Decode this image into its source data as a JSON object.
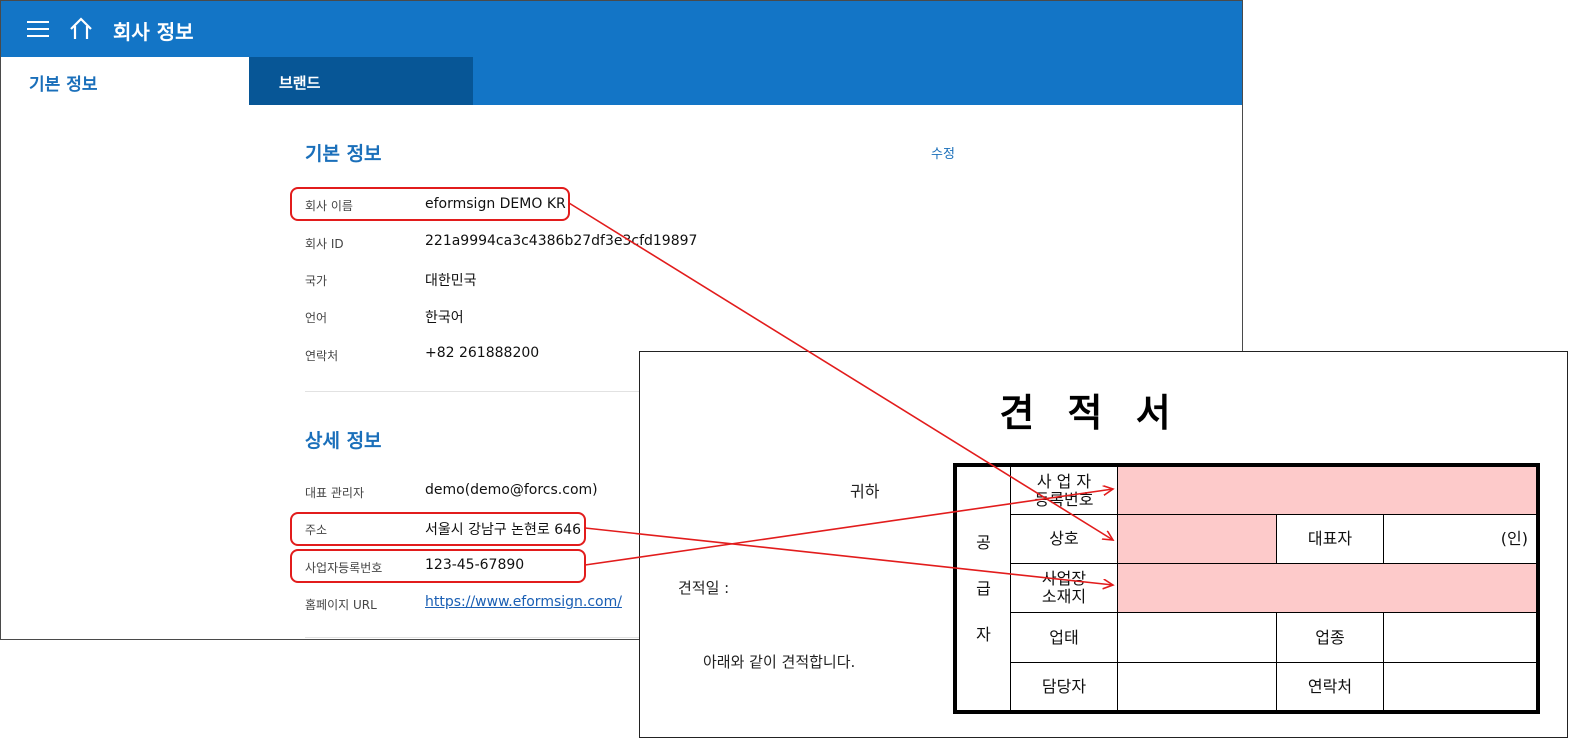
{
  "app": {
    "title": "회사 정보",
    "tabs": {
      "basic": "기본 정보",
      "brand": "브랜드"
    }
  },
  "basic_info": {
    "title": "기본 정보",
    "edit": "수정",
    "fields": [
      {
        "label": "회사 이름",
        "value": "eformsign DEMO KR"
      },
      {
        "label": "회사 ID",
        "value": "221a9994ca3c4386b27df3e3cfd19897"
      },
      {
        "label": "국가",
        "value": "대한민국"
      },
      {
        "label": "언어",
        "value": "한국어"
      },
      {
        "label": "연락처",
        "value": "+82 261888200"
      }
    ]
  },
  "detail_info": {
    "title": "상세 정보",
    "fields": [
      {
        "label": "대표 관리자",
        "value": "demo(demo@forcs.com)"
      },
      {
        "label": "주소",
        "value": "서울시 강남구 논현로 646"
      },
      {
        "label": "사업자등록번호",
        "value": "123-45-67890"
      },
      {
        "label": "홈페이지 URL",
        "value": "https://www.eformsign.com/"
      }
    ]
  },
  "quote": {
    "title": "견 적 서",
    "recipient": "귀하",
    "date_label": "견적일 :",
    "statement": "아래와 같이 견적합니다.",
    "supplier": {
      "side_label": [
        "공",
        "급",
        "자"
      ],
      "reg_no": "사 업 자\n등록번호",
      "company": "상호",
      "ceo": "대표자",
      "seal": "(인)",
      "address": "사업장\n소재지",
      "business_type": "업태",
      "business_item": "업종",
      "manager": "담당자",
      "contact": "연락처"
    }
  },
  "colors": {
    "brand_blue": "#1375c6",
    "brand_dark": "#075696",
    "highlight_red": "#e21c1c",
    "field_pink": "#fdcaca"
  }
}
